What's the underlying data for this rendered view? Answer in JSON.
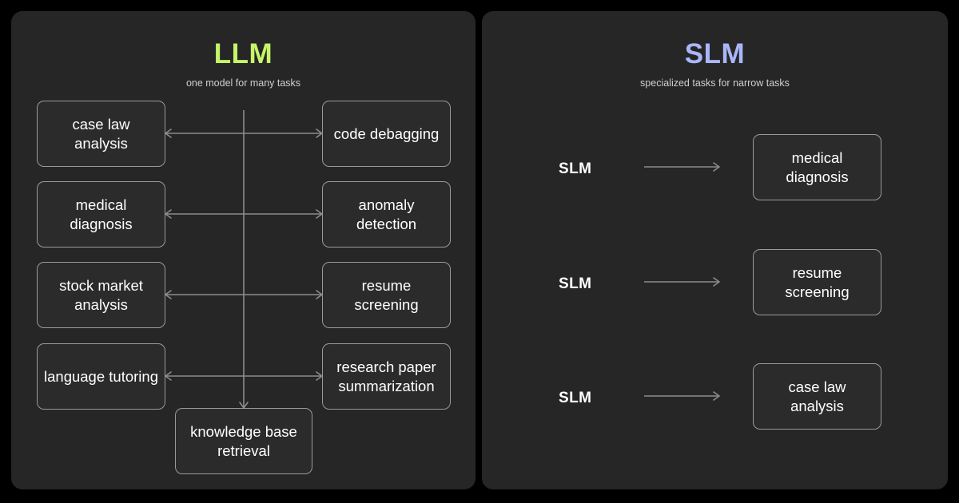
{
  "theme": {
    "page_background": "#000000",
    "panel_background": "#262626",
    "box_background": "#2b2b2b",
    "box_border": "#9a9a9a",
    "connector": "#8c8c8c",
    "llm_accent": "#c6f56a",
    "slm_accent": "#aab6f8",
    "text": "#ffffff",
    "subtitle_text": "#cfcfcf"
  },
  "left_panel": {
    "title": "LLM",
    "subtitle": "one model for many tasks",
    "left_column": [
      {
        "label": "case law analysis"
      },
      {
        "label": "medical diagnosis"
      },
      {
        "label": "stock market analysis"
      },
      {
        "label": "language tutoring"
      }
    ],
    "right_column": [
      {
        "label": "code debagging"
      },
      {
        "label": "anomaly detection"
      },
      {
        "label": "resume screening"
      },
      {
        "label": "research paper summarization"
      }
    ],
    "bottom_node": {
      "label": "knowledge base retrieval"
    }
  },
  "right_panel": {
    "title": "SLM",
    "subtitle": "specialized tasks for narrow tasks",
    "rows": [
      {
        "model_label": "SLM",
        "task_label": "medical diagnosis"
      },
      {
        "model_label": "SLM",
        "task_label": "resume screening"
      },
      {
        "model_label": "SLM",
        "task_label": "case law analysis"
      }
    ]
  }
}
